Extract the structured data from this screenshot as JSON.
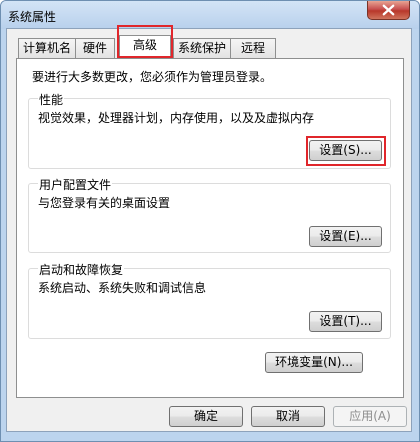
{
  "window": {
    "title": "系统属性"
  },
  "tabs": [
    {
      "label": "计算机名"
    },
    {
      "label": "硬件"
    },
    {
      "label": "高级"
    },
    {
      "label": "系统保护"
    },
    {
      "label": "远程"
    }
  ],
  "advanced": {
    "admin_note": "要进行大多数更改，您必须作为管理员登录。",
    "performance": {
      "title": "性能",
      "description": "视觉效果，处理器计划，内存使用，以及及虚拟内存",
      "button": "设置(S)..."
    },
    "user_profiles": {
      "title": "用户配置文件",
      "description": "与您登录有关的桌面设置",
      "button": "设置(E)..."
    },
    "startup_recovery": {
      "title": "启动和故障恢复",
      "description": "系统启动、系统失败和调试信息",
      "button": "设置(T)..."
    },
    "env_button": "环境变量(N)..."
  },
  "dialog_buttons": {
    "ok": "确定",
    "cancel": "取消",
    "apply": "应用(A)"
  },
  "colors": {
    "highlight": "#e0262b",
    "close_button": "#c75050",
    "titlebar": "#bcd4ee"
  },
  "icons": {
    "close": "close-icon"
  }
}
